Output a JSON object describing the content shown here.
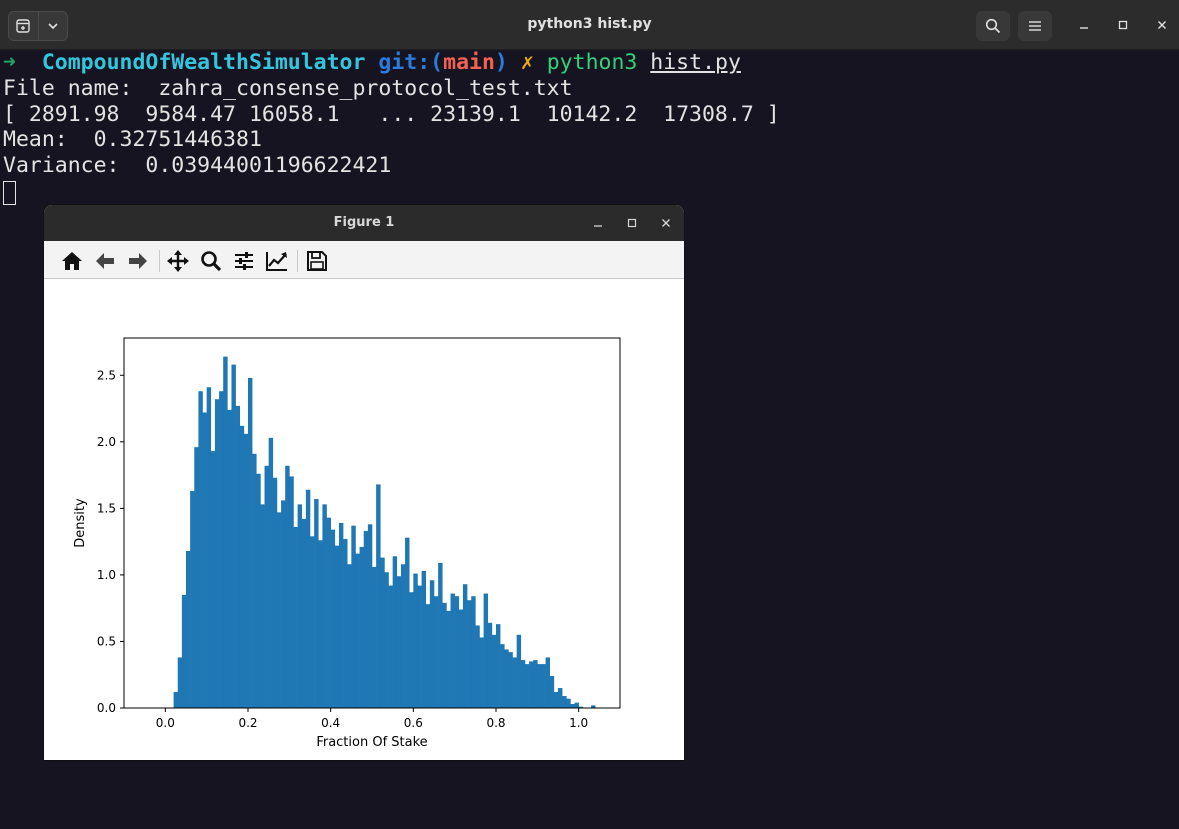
{
  "terminal": {
    "title": "python3 hist.py",
    "prompt_arrow": "➜",
    "directory": "CompoundOfWealthSimulator",
    "git_prefix": "git:(",
    "branch": "main",
    "git_suffix": ")",
    "dirty_mark": "✗",
    "command": "python3",
    "argument": "hist.py",
    "output_lines": [
      "File name:  zahra_consense_protocol_test.txt",
      "[ 2891.98  9584.47 16058.1   ... 23139.1  10142.2  17308.7 ]",
      "Mean:  0.32751446381",
      "Variance:  0.03944001196622421"
    ]
  },
  "figure_window": {
    "title": "Figure 1",
    "toolbar": [
      "home-icon",
      "back-icon",
      "forward-icon",
      "pan-icon",
      "zoom-icon",
      "configure-subplots-icon",
      "edit-axis-icon",
      "save-icon"
    ]
  },
  "chart_data": {
    "type": "bar",
    "title": "",
    "xlabel": "Fraction Of Stake",
    "ylabel": "Density",
    "xlim": [
      -0.1,
      1.1
    ],
    "ylim": [
      0,
      2.78
    ],
    "xticks": [
      "0.0",
      "0.2",
      "0.4",
      "0.6",
      "0.8",
      "1.0"
    ],
    "xtick_values": [
      0.0,
      0.2,
      0.4,
      0.6,
      0.8,
      1.0
    ],
    "yticks": [
      "0.0",
      "0.5",
      "1.0",
      "1.5",
      "2.0",
      "2.5"
    ],
    "ytick_values": [
      0.0,
      0.5,
      1.0,
      1.5,
      2.0,
      2.5
    ],
    "bar_color": "#1f77b4",
    "bin_start": 0.02,
    "bin_width": 0.01,
    "values": [
      0.12,
      0.38,
      0.85,
      1.18,
      1.63,
      1.96,
      2.38,
      2.22,
      2.41,
      1.93,
      2.32,
      2.38,
      2.64,
      2.24,
      2.58,
      2.27,
      2.12,
      2.06,
      2.48,
      1.91,
      1.76,
      1.53,
      1.82,
      2.03,
      1.73,
      1.47,
      1.56,
      1.82,
      1.74,
      1.36,
      1.53,
      1.42,
      1.64,
      1.29,
      1.57,
      1.26,
      1.53,
      1.43,
      1.34,
      1.22,
      1.39,
      1.27,
      1.08,
      1.37,
      1.16,
      1.21,
      1.33,
      1.38,
      1.06,
      1.68,
      1.13,
      1.02,
      0.92,
      1.14,
      0.99,
      1.08,
      1.28,
      0.87,
      1.01,
      0.92,
      1.03,
      0.78,
      0.96,
      0.84,
      1.09,
      0.79,
      0.73,
      0.86,
      0.84,
      0.74,
      0.93,
      0.81,
      0.84,
      0.62,
      0.53,
      0.86,
      0.64,
      0.55,
      0.63,
      0.48,
      0.44,
      0.42,
      0.38,
      0.55,
      0.36,
      0.33,
      0.35,
      0.36,
      0.33,
      0.33,
      0.38,
      0.24,
      0.12,
      0.15,
      0.09,
      0.07,
      0.03,
      0.04,
      0.01,
      0.0,
      0.0,
      0.02,
      0.0,
      0.0,
      0.0,
      0.0,
      0.0,
      0.0,
      0.0,
      0.0,
      0.0,
      0.0,
      0.0
    ]
  }
}
